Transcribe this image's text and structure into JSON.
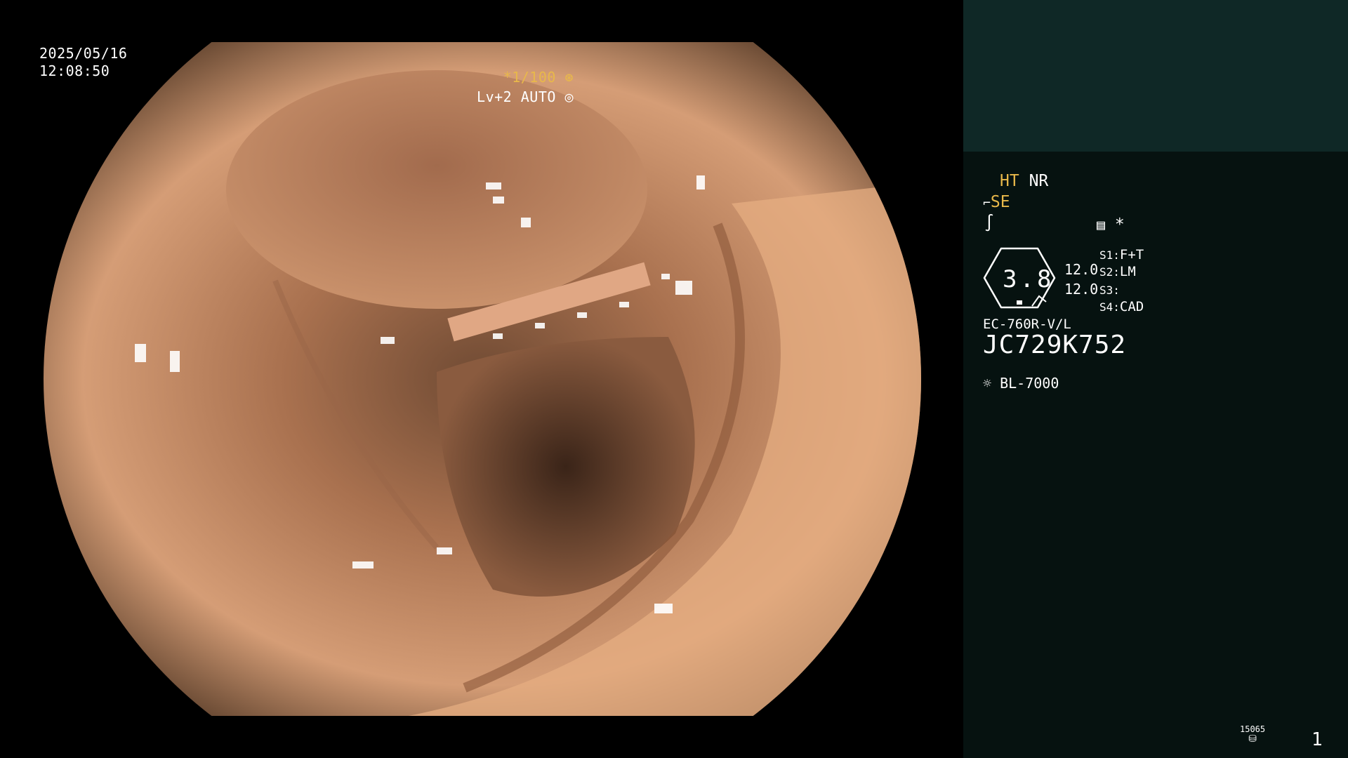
{
  "overlay": {
    "date": "2025/05/16",
    "time": "12:08:50",
    "shutter": "*1/100",
    "level": "Lv+2 AUTO"
  },
  "panel": {
    "ht": "HT",
    "nr": "NR",
    "se": "SE",
    "ring_value": "3.8",
    "val1": "12.0",
    "val2": "12.0",
    "s1_label": "S1:",
    "s1": "F+T",
    "s2_label": "S2:",
    "s2": "LM",
    "s3_label": "S3:",
    "s3": "",
    "s4_label": "S4:",
    "s4": "CAD",
    "model": "EC-760R-V/L",
    "serial": "JC729K752",
    "light": "BL-7000",
    "counter_code": "15065",
    "page": "1",
    "asterisk": "*"
  },
  "colors": {
    "accent_yellow": "#e8b84a",
    "panel_bg": "#061210",
    "panel_top": "#0f2826"
  }
}
